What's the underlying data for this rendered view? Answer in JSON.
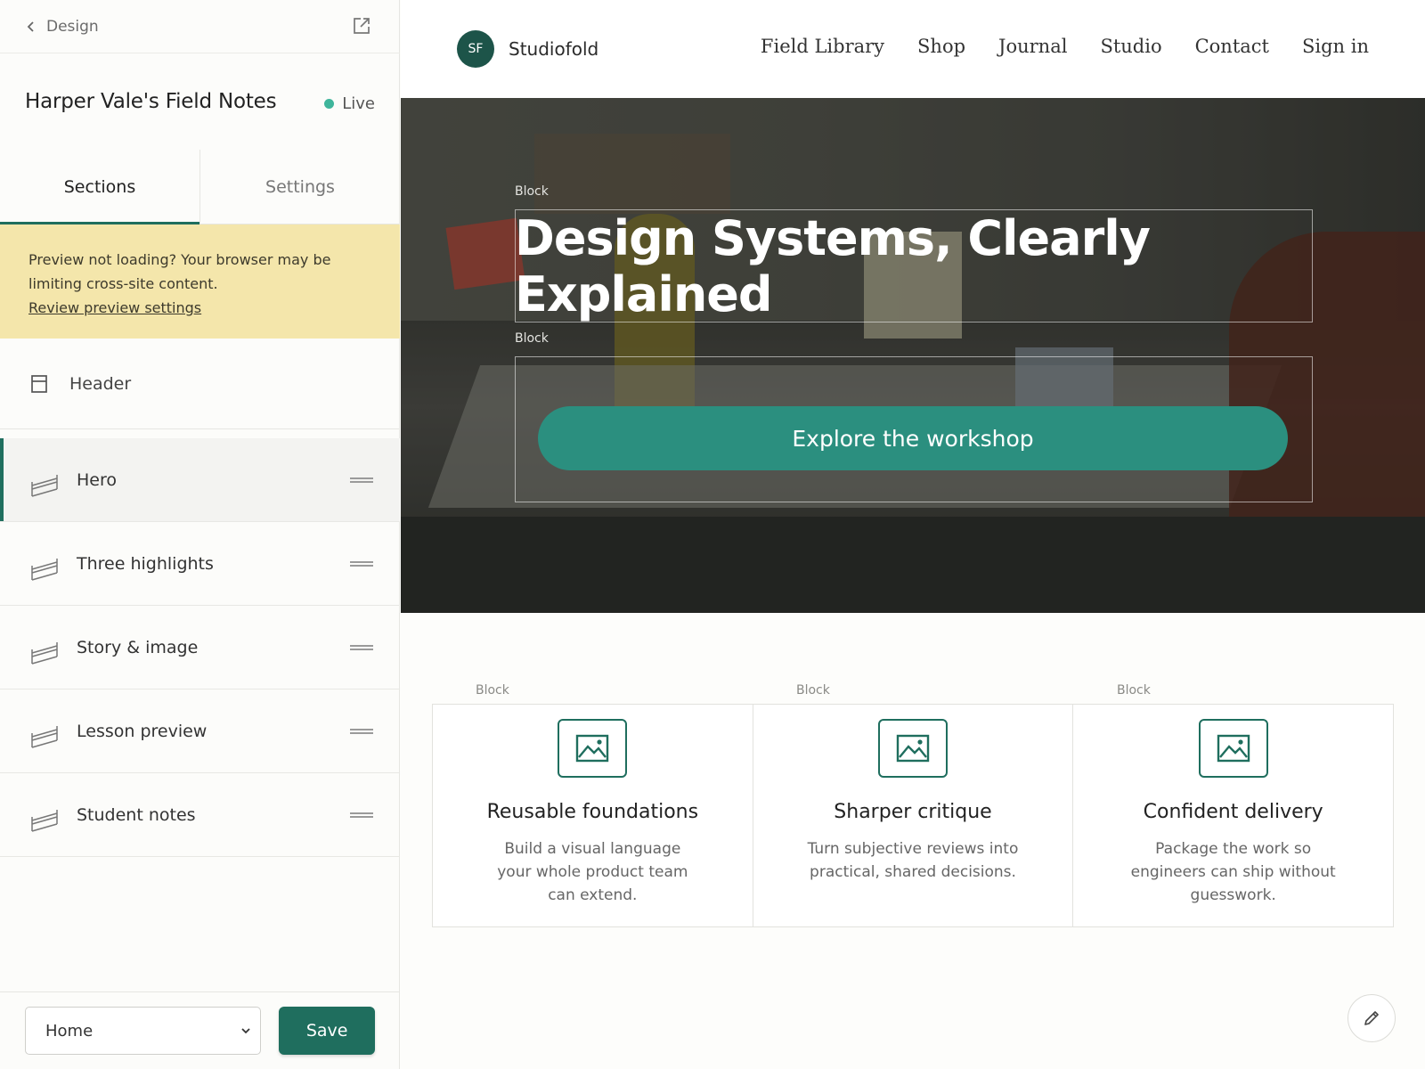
{
  "editor": {
    "back_label": "Design",
    "site_title": "Harper Vale's Field Notes",
    "status": "Live",
    "tabs": [
      {
        "label": "Sections",
        "active": true
      },
      {
        "label": "Settings",
        "active": false
      }
    ],
    "notice": {
      "text": "Preview not loading? Your browser may be limiting cross-site content.",
      "link": "Review preview settings"
    },
    "header_section": {
      "label": "Header",
      "icon": "header-layout-icon"
    },
    "sections": [
      {
        "label": "Hero",
        "active": true
      },
      {
        "label": "Three highlights",
        "active": false
      },
      {
        "label": "Story & image",
        "active": false
      },
      {
        "label": "Lesson preview",
        "active": false
      },
      {
        "label": "Student notes",
        "active": false
      }
    ],
    "page_select": {
      "value": "Home"
    },
    "save_label": "Save"
  },
  "preview": {
    "brand": {
      "initials": "SF",
      "name": "Studiofold"
    },
    "nav_links": [
      "Field Library",
      "Shop",
      "Journal",
      "Studio",
      "Contact",
      "Sign in"
    ],
    "block_label": "Block",
    "hero": {
      "title": "Design Systems, Clearly Explained",
      "cta": "Explore the workshop"
    },
    "features": [
      {
        "title": "Reusable foundations",
        "body": "Build a visual language your whole product team can extend."
      },
      {
        "title": "Sharper critique",
        "body": "Turn subjective reviews into practical, shared decisions."
      },
      {
        "title": "Confident delivery",
        "body": "Package the work so engineers can ship without guesswork."
      }
    ]
  },
  "colors": {
    "accent": "#1f6e5e",
    "cta": "#2b8f7f",
    "notice_bg": "#f4e6ab",
    "live_dot": "#3fb59b"
  }
}
